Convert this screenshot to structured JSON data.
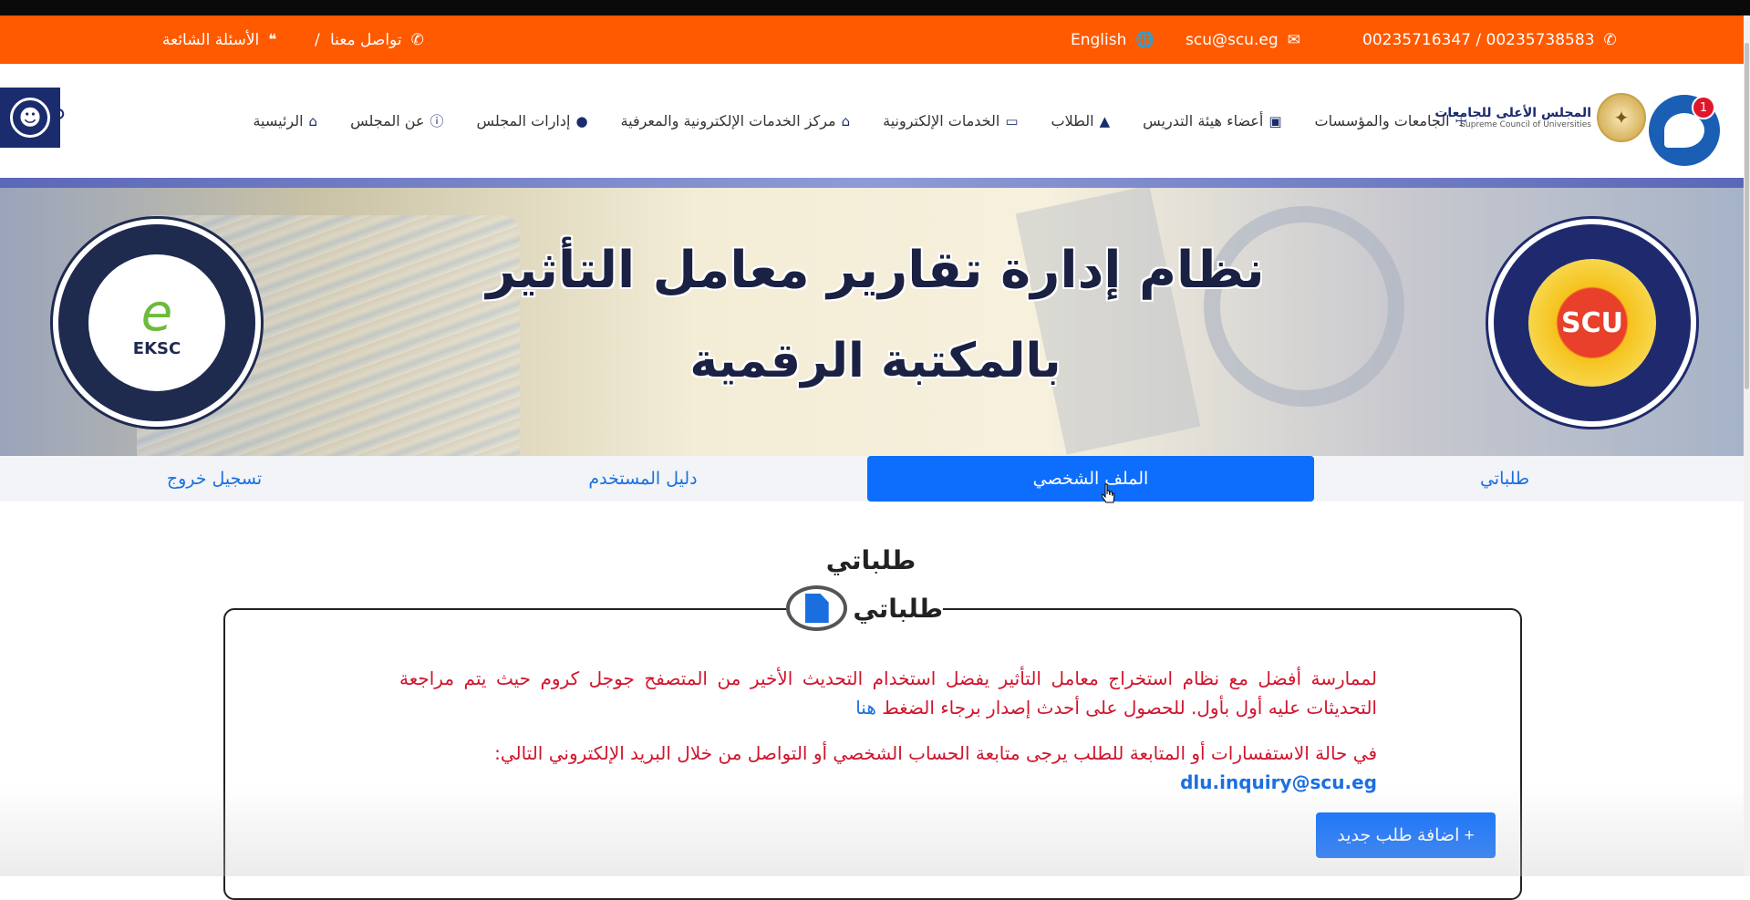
{
  "topbar": {
    "phones": "00235738583 / 00235716347",
    "email": "scu@scu.eg",
    "language": "English",
    "contact": "تواصل معنا",
    "faq": "الأسئلة الشائعة",
    "separator": "/",
    "icons": {
      "phone": "phone-icon",
      "email": "envelope-icon",
      "language": "globe-icon",
      "contact": "phone-icon",
      "faq": "quote-icon"
    }
  },
  "logo": {
    "arabic": "المجلس الأعلى للجامعات",
    "english": "Supreme Council of Universities"
  },
  "chat": {
    "badge": "1"
  },
  "nav": [
    {
      "label": "الرئيسية",
      "icon": "home-icon"
    },
    {
      "label": "عن المجلس",
      "icon": "info-icon"
    },
    {
      "label": "إدارات المجلس",
      "icon": "users-icon"
    },
    {
      "label": "مركز الخدمات الإلكترونية والمعرفية",
      "icon": "building-icon"
    },
    {
      "label": "الخدمات الإلكترونية",
      "icon": "laptop-icon"
    },
    {
      "label": "الطلاب",
      "icon": "graduation-cap-icon"
    },
    {
      "label": "أعضاء هيئة التدريس",
      "icon": "teacher-icon"
    },
    {
      "label": "الجامعات والمؤسسات",
      "icon": "institution-icon"
    }
  ],
  "banner": {
    "line1": "نظام إدارة تقارير معامل التأثير",
    "line2": "بالمكتبة الرقمية",
    "eksc_label": "EKSC",
    "scu_label": "SCU"
  },
  "tabs": {
    "my_requests": "طلباتي",
    "profile": "الملف الشخصي",
    "user_guide": "دليل المستخدم",
    "logout": "تسجيل خروج"
  },
  "content": {
    "page_title": "طلباتي",
    "section_title": "طلباتي",
    "notice1": "لممارسة أفضل مع نظام استخراج معامل التأثير يفضل استخدام التحديث الأخير من المتصفح جوجل كروم حيث يتم مراجعة التحديثات عليه أول بأول. للحصول على أحدث إصدار برجاء الضغط ",
    "notice1_link": "هنا",
    "notice2": "في حالة الاستفسارات أو المتابعة للطلب يرجى متابعة الحساب الشخصي أو التواصل من خلال البريد الإلكتروني التالي:",
    "inquiry_email": "dlu.inquiry@scu.eg",
    "add_button": "+ اضافة طلب جديد"
  },
  "colors": {
    "topbar": "#ff5a00",
    "primary": "#0d6efd",
    "navy": "#1a2b6e",
    "notice_red": "#d0142c"
  }
}
